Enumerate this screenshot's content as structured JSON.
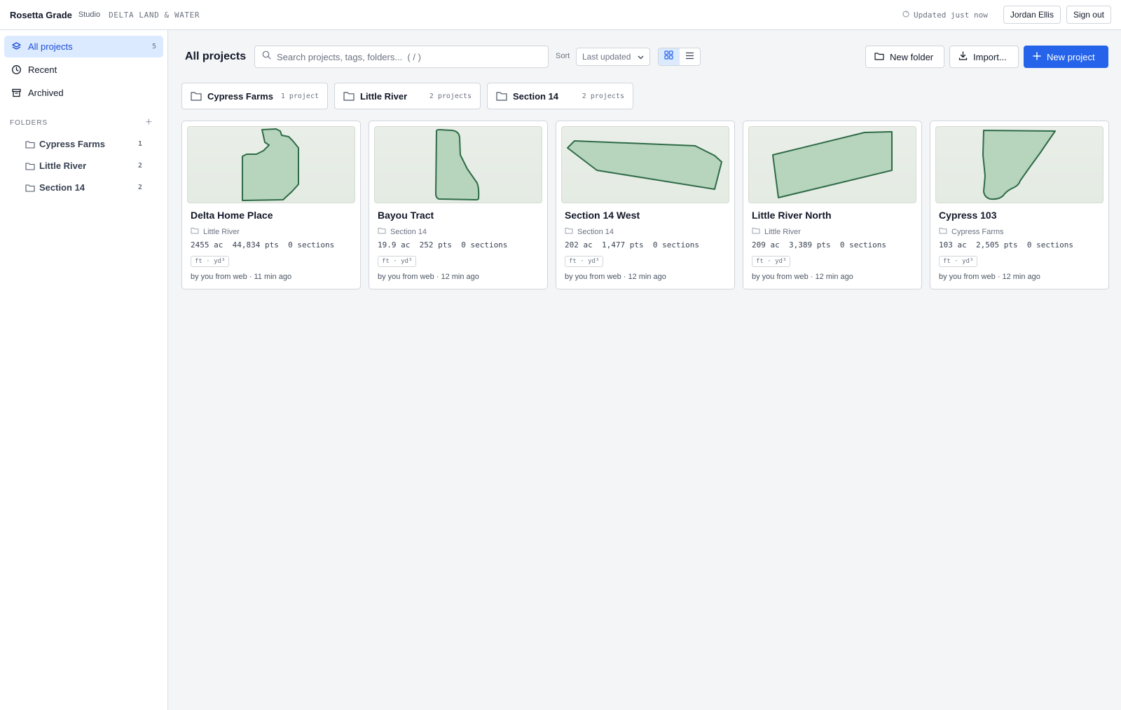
{
  "app": {
    "name": "Rosetta Grade",
    "product": "Studio",
    "org": "DELTA LAND & WATER",
    "sync_status": "Updated just now",
    "user_name": "Jordan Ellis",
    "sign_out_label": "Sign out"
  },
  "sidebar": {
    "nav": [
      {
        "label": "All projects",
        "count": "5",
        "icon": "layers-icon",
        "active": true
      },
      {
        "label": "Recent",
        "count": "",
        "icon": "clock-icon",
        "active": false
      },
      {
        "label": "Archived",
        "count": "",
        "icon": "archive-icon",
        "active": false
      }
    ],
    "folders_heading": "FOLDERS",
    "folders": [
      {
        "label": "Cypress Farms",
        "count": "1"
      },
      {
        "label": "Little River",
        "count": "2"
      },
      {
        "label": "Section 14",
        "count": "2"
      }
    ]
  },
  "toolbar": {
    "title": "All projects",
    "search_placeholder": "Search projects, tags, folders...  ( / )",
    "sort_label": "Sort",
    "sort_value": "Last updated",
    "view_mode": "grid",
    "new_folder_label": "New folder",
    "import_label": "Import...",
    "new_project_label": "New project"
  },
  "folder_chips": [
    {
      "name": "Cypress Farms",
      "count": "1 project"
    },
    {
      "name": "Little River",
      "count": "2 projects"
    },
    {
      "name": "Section 14",
      "count": "2 projects"
    }
  ],
  "projects": [
    {
      "title": "Delta Home Place",
      "folder": "Little River",
      "stats": "2455 ac  44,834 pts  0 sections",
      "units": "ft · yd³",
      "meta": "by you from web · 11 min ago"
    },
    {
      "title": "Bayou Tract",
      "folder": "Section 14",
      "stats": "19.9 ac  252 pts  0 sections",
      "units": "ft · yd³",
      "meta": "by you from web · 12 min ago"
    },
    {
      "title": "Section 14 West",
      "folder": "Section 14",
      "stats": "202 ac  1,477 pts  0 sections",
      "units": "ft · yd³",
      "meta": "by you from web · 12 min ago"
    },
    {
      "title": "Little River North",
      "folder": "Little River",
      "stats": "209 ac  3,389 pts  0 sections",
      "units": "ft · yd³",
      "meta": "by you from web · 12 min ago"
    },
    {
      "title": "Cypress 103",
      "folder": "Cypress Farms",
      "stats": "103 ac  2,505 pts  0 sections",
      "units": "ft · yd³",
      "meta": "by you from web · 12 min ago"
    }
  ],
  "colors": {
    "accent": "#2563eb",
    "active_nav_bg": "#dbeafe",
    "parcel_fill": "#b7d4bd",
    "parcel_stroke": "#2e6b47"
  }
}
